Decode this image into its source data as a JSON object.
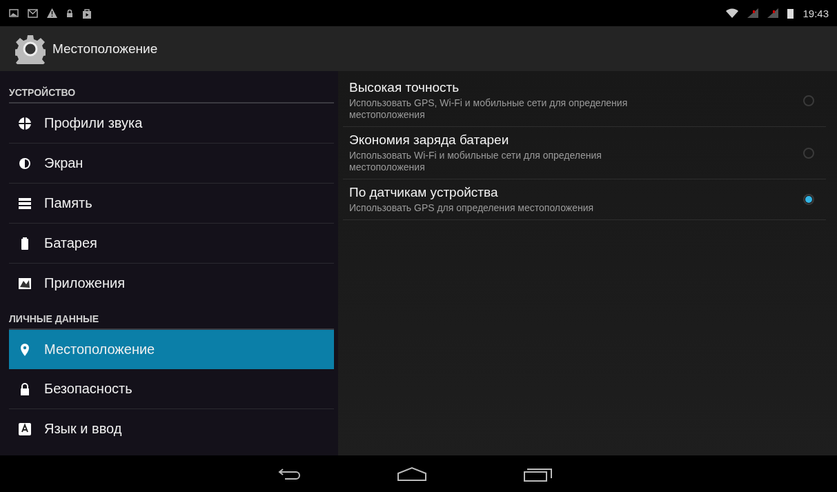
{
  "status_bar": {
    "time": "19:43"
  },
  "action_bar": {
    "title": "Местоположение"
  },
  "sidebar": {
    "items": [
      {
        "kind": "header",
        "label": "УСТРОЙСТВО"
      },
      {
        "kind": "item",
        "label": "Профили звука",
        "selected": false
      },
      {
        "kind": "item",
        "label": "Экран",
        "selected": false
      },
      {
        "kind": "item",
        "label": "Память",
        "selected": false
      },
      {
        "kind": "item",
        "label": "Батарея",
        "selected": false
      },
      {
        "kind": "item",
        "label": "Приложения",
        "selected": false
      },
      {
        "kind": "header",
        "label": "ЛИЧНЫЕ ДАННЫЕ"
      },
      {
        "kind": "item",
        "label": "Местоположение",
        "selected": true
      },
      {
        "kind": "item",
        "label": "Безопасность",
        "selected": false
      },
      {
        "kind": "item",
        "label": "Язык и ввод",
        "selected": false
      }
    ]
  },
  "modes": [
    {
      "title": "Высокая точность",
      "summary": "Использовать GPS, Wi-Fi и мобильные сети для определения местоположения",
      "selected": false
    },
    {
      "title": "Экономия заряда батареи",
      "summary": "Использовать Wi-Fi и мобильные сети для определения местоположения",
      "selected": false
    },
    {
      "title": "По датчикам устройства",
      "summary": "Использовать GPS для определения местоположения",
      "selected": true
    }
  ]
}
